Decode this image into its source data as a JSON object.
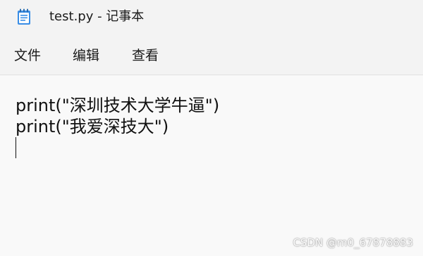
{
  "window": {
    "title": "test.py - 记事本",
    "app_icon": "notepad-icon"
  },
  "menu": {
    "file": "文件",
    "edit": "编辑",
    "view": "查看"
  },
  "editor": {
    "lines": [
      "print(\"深圳技术大学牛逼\")",
      "print(\"我爱深技大\")"
    ]
  },
  "watermark": "CSDN @m0_67878883",
  "colors": {
    "chrome_background": "#f3f3f3",
    "editor_background": "#f9f9f9",
    "text": "#111111",
    "icon_accent": "#3a8ee6"
  }
}
